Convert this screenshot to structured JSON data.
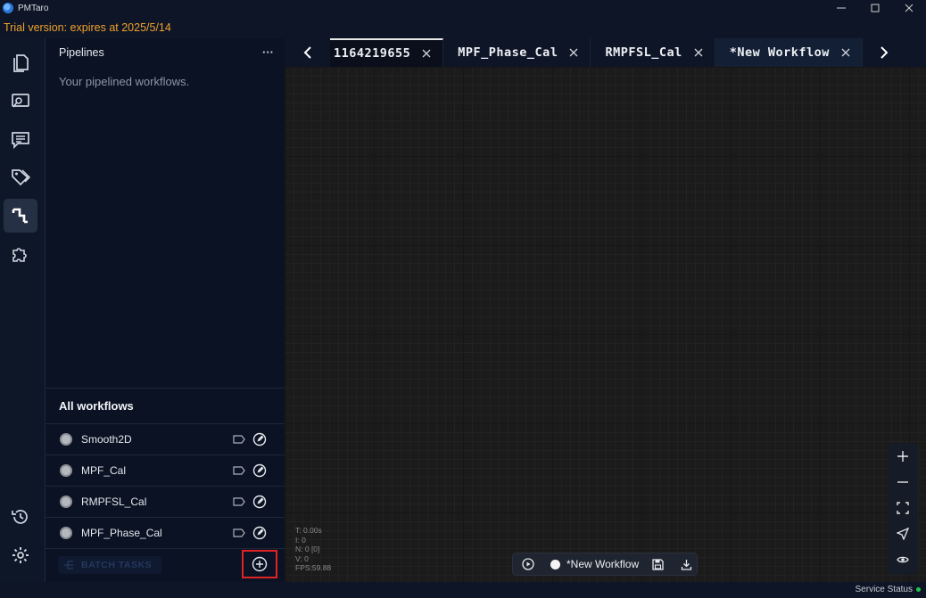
{
  "app": {
    "title": "PMTaro"
  },
  "trial": {
    "text": "Trial version: expires at 2025/5/14"
  },
  "colors": {
    "trial": "#f0a12b",
    "status_ok": "#1ec84a",
    "highlight": "#e02424"
  },
  "rail": {
    "items": [
      {
        "icon": "documents-icon"
      },
      {
        "icon": "monitor-search-icon"
      },
      {
        "icon": "chat-icon"
      },
      {
        "icon": "tags-icon"
      },
      {
        "icon": "pipeline-icon",
        "active": true
      },
      {
        "icon": "puzzle-icon"
      }
    ],
    "bottom": [
      {
        "icon": "history-icon"
      },
      {
        "icon": "settings-icon"
      }
    ]
  },
  "pipelines": {
    "title": "Pipelines",
    "more": "···",
    "empty_text": "Your pipelined workflows."
  },
  "workflows": {
    "title": "All workflows",
    "items": [
      {
        "name": "Smooth2D"
      },
      {
        "name": "MPF_Cal"
      },
      {
        "name": "RMPFSL_Cal"
      },
      {
        "name": "MPF_Phase_Cal"
      }
    ],
    "batch_label": "BATCH TASKS"
  },
  "tabs": [
    {
      "label": "1164219655",
      "active": true
    },
    {
      "label": "MPF_Phase_Cal"
    },
    {
      "label": "RMPFSL_Cal"
    },
    {
      "label": "*New Workflow",
      "current": true
    }
  ],
  "canvas": {
    "stats": [
      "T: 0.00s",
      "I: 0",
      "N: 0 [0]",
      "V: 0",
      "FPS:59.88"
    ],
    "workflow_name": "*New Workflow"
  },
  "status": {
    "text": "Service Status"
  }
}
